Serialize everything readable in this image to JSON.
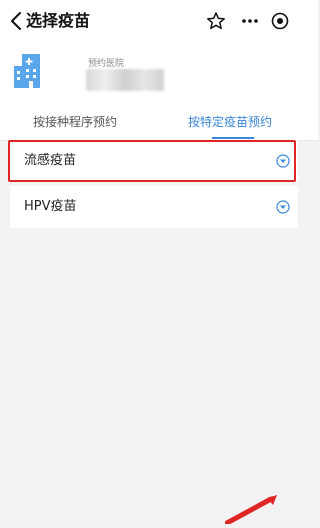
{
  "header": {
    "title": "选择疫苗"
  },
  "hospital": {
    "label": "预约医院"
  },
  "tabs": [
    {
      "label": "按接种程序预约",
      "active": false
    },
    {
      "label": "按特定疫苗预约",
      "active": true
    }
  ],
  "vaccines": [
    {
      "label": "流感疫苗",
      "highlighted": true
    },
    {
      "label": "HPV疫苗",
      "highlighted": false
    }
  ],
  "colors": {
    "accent": "#3a87d9",
    "highlight": "#e02525",
    "background": "#f3f3f3"
  },
  "icons": [
    "back-icon",
    "star-icon",
    "more-icon",
    "target-icon",
    "hospital-building-icon",
    "chevron-down-circle-icon"
  ]
}
